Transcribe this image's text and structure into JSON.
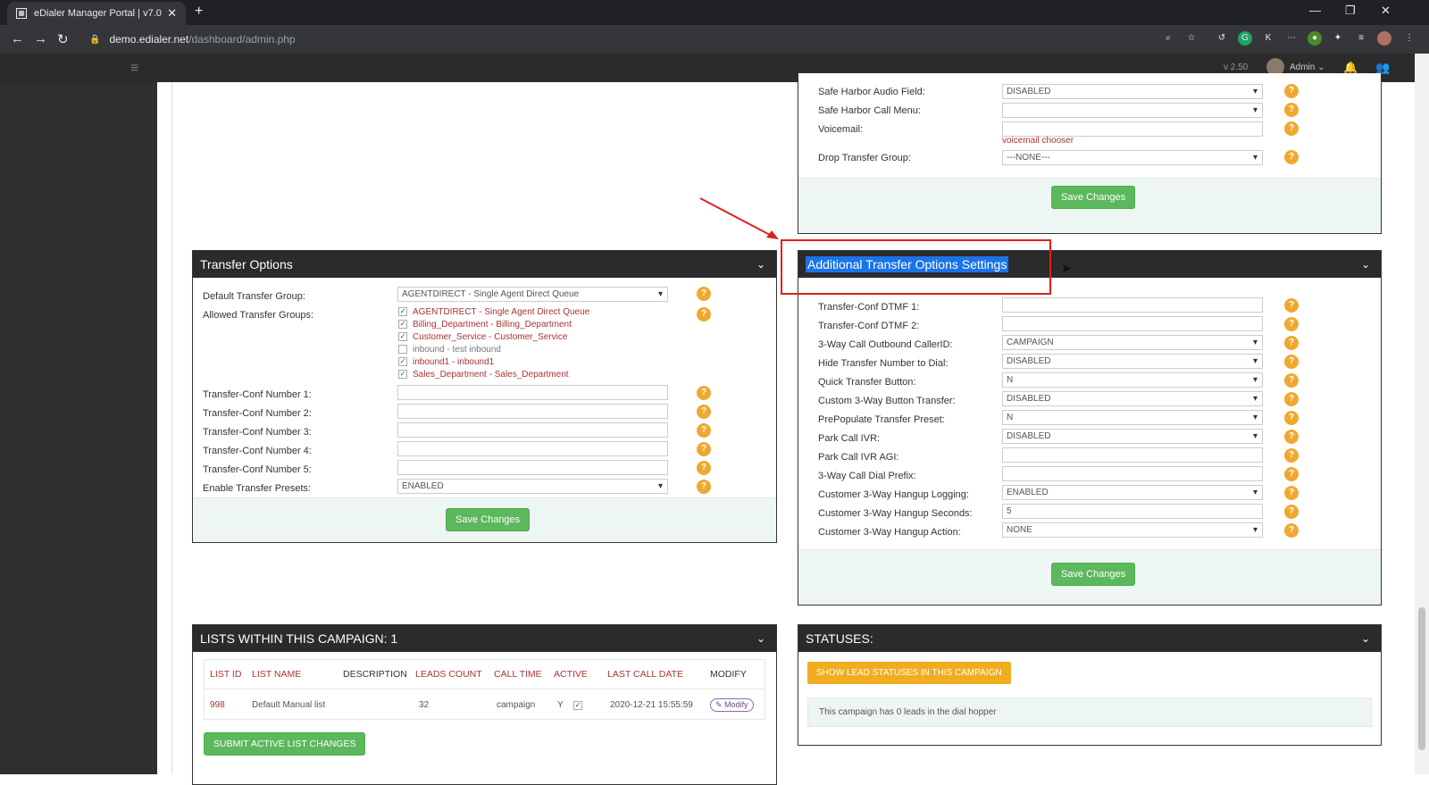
{
  "browser": {
    "tab_title": "eDialer Manager Portal | v7.0",
    "url_domain": "demo.edialer.net",
    "url_path": "/dashboard/admin.php"
  },
  "app_header": {
    "version": "v 2.50",
    "user": "Admin"
  },
  "top_right_panel": {
    "rows": [
      {
        "label": "Safe Harbor Audio Field:",
        "type": "select",
        "value": "DISABLED"
      },
      {
        "label": "Safe Harbor Call Menu:",
        "type": "select",
        "value": ""
      },
      {
        "label": "Voicemail:",
        "type": "input",
        "value": "",
        "link": "voicemail chooser"
      },
      {
        "label": "Drop Transfer Group:",
        "type": "select",
        "value": "---NONE---"
      }
    ],
    "save_label": "Save Changes"
  },
  "transfer_options": {
    "title": "Transfer Options",
    "default_group_label": "Default Transfer Group:",
    "default_group_value": "AGENTDIRECT - Single Agent Direct Queue",
    "allowed_label": "Allowed Transfer Groups:",
    "allowed_groups": [
      {
        "id": "AGENTDIRECT",
        "desc": "Single Agent Direct Queue",
        "checked": true
      },
      {
        "id": "Billing_Department",
        "desc": "Billing_Department",
        "checked": true
      },
      {
        "id": "Customer_Service",
        "desc": "Customer_Service",
        "checked": true
      },
      {
        "id": "inbound",
        "desc": "test inbound",
        "checked": false
      },
      {
        "id": "inbound1",
        "desc": "inbound1",
        "checked": true
      },
      {
        "id": "Sales_Department",
        "desc": "Sales_Department",
        "checked": true
      }
    ],
    "conf_numbers": [
      {
        "label": "Transfer-Conf Number 1:",
        "value": ""
      },
      {
        "label": "Transfer-Conf Number 2:",
        "value": ""
      },
      {
        "label": "Transfer-Conf Number 3:",
        "value": ""
      },
      {
        "label": "Transfer-Conf Number 4:",
        "value": ""
      },
      {
        "label": "Transfer-Conf Number 5:",
        "value": ""
      }
    ],
    "presets_label": "Enable Transfer Presets:",
    "presets_value": "ENABLED",
    "save_label": "Save Changes"
  },
  "additional_transfer": {
    "title": "Additional Transfer Options Settings",
    "rows": [
      {
        "label": "Transfer-Conf DTMF 1:",
        "type": "input",
        "value": ""
      },
      {
        "label": "Transfer-Conf DTMF 2:",
        "type": "input",
        "value": ""
      },
      {
        "label": "3-Way Call Outbound CallerID:",
        "type": "select",
        "value": "CAMPAIGN"
      },
      {
        "label": "Hide Transfer Number to Dial:",
        "type": "select",
        "value": "DISABLED"
      },
      {
        "label": "Quick Transfer Button:",
        "type": "select",
        "value": "N"
      },
      {
        "label": "Custom 3-Way Button Transfer:",
        "type": "select",
        "value": "DISABLED"
      },
      {
        "label": "PrePopulate Transfer Preset:",
        "type": "select",
        "value": "N"
      },
      {
        "label": "Park Call IVR:",
        "type": "select",
        "value": "DISABLED"
      },
      {
        "label": "Park Call IVR AGI:",
        "type": "input",
        "value": ""
      },
      {
        "label": "3-Way Call Dial Prefix:",
        "type": "input",
        "value": ""
      },
      {
        "label": "Customer 3-Way Hangup Logging:",
        "type": "select",
        "value": "ENABLED"
      },
      {
        "label": "Customer 3-Way Hangup Seconds:",
        "type": "input",
        "value": "5"
      },
      {
        "label": "Customer 3-Way Hangup Action:",
        "type": "select",
        "value": "NONE"
      }
    ],
    "save_label": "Save Changes"
  },
  "lists_panel": {
    "title": "LISTS WITHIN THIS CAMPAIGN: 1",
    "columns": [
      "LIST ID",
      "LIST NAME",
      "DESCRIPTION",
      "LEADS COUNT",
      "CALL TIME",
      "ACTIVE",
      "LAST CALL DATE",
      "MODIFY"
    ],
    "row": {
      "list_id": "998",
      "list_name": "Default Manual list",
      "description": "",
      "leads_count": "32",
      "call_time": "campaign",
      "active": "Y",
      "last_call_date": "2020-12-21 15:55:59",
      "modify": "Modify"
    },
    "submit_label": "SUBMIT ACTIVE LIST CHANGES"
  },
  "statuses_panel": {
    "title": "STATUSES:",
    "button_label": "SHOW LEAD STATUSES IN THIS CAMPAIGN",
    "hopper_text": "This campaign has 0 leads in the dial hopper"
  }
}
